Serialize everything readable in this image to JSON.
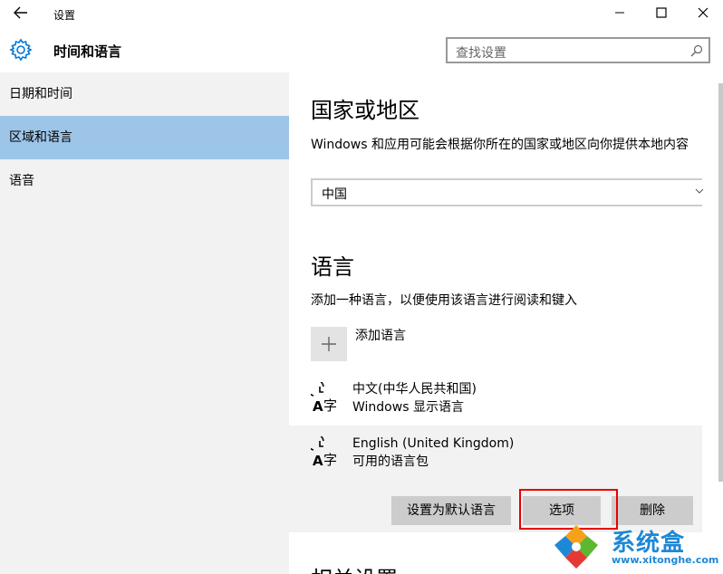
{
  "window": {
    "title": "设置",
    "back_icon": "back-arrow-icon",
    "minimize": "—",
    "maximize": "☐",
    "close": "✕"
  },
  "header": {
    "icon": "gear-icon",
    "section_title": "时间和语言",
    "search_placeholder": "查找设置",
    "search_icon": "search-icon"
  },
  "sidebar": {
    "items": [
      {
        "label": "日期和时间",
        "active": false
      },
      {
        "label": "区域和语言",
        "active": true
      },
      {
        "label": "语音",
        "active": false
      }
    ]
  },
  "main": {
    "region": {
      "heading": "国家或地区",
      "description": "Windows 和应用可能会根据你所在的国家或地区向你提供本地内容",
      "selected_country": "中国"
    },
    "language": {
      "heading": "语言",
      "description": "添加一种语言，以便使用该语言进行阅读和键入",
      "add_label": "添加语言",
      "add_icon": "plus-icon",
      "items": [
        {
          "name": "中文(中华人民共和国)",
          "detail": "Windows 显示语言",
          "icon": "language-icon"
        },
        {
          "name": "English (United Kingdom)",
          "detail": "可用的语言包",
          "icon": "language-icon"
        }
      ],
      "buttons": {
        "set_default": "设置为默认语言",
        "options": "选项",
        "remove": "删除"
      }
    },
    "partial_heading": "相关设置"
  },
  "watermark": {
    "brand": "系统盒",
    "url": "www.xitonghe.com"
  },
  "colors": {
    "selected_nav": "#9dc5e8",
    "highlight_border": "#e60000",
    "accent": "#0078d7"
  }
}
